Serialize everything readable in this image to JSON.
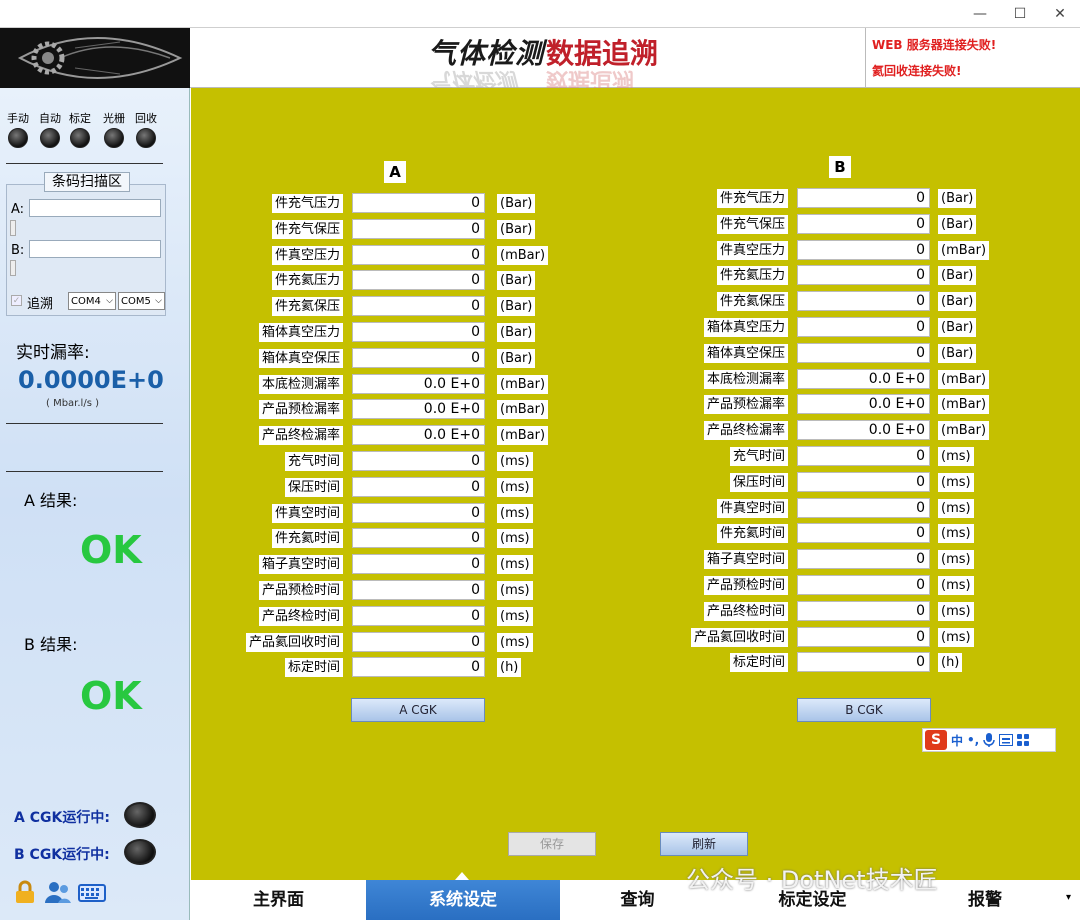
{
  "window": {
    "minimize": "—",
    "maximize": "☐",
    "close": "✕"
  },
  "header": {
    "title_part1": "气体检测",
    "title_part2": "数据追溯",
    "alert1": "WEB 服务器连接失败!",
    "alert2": "氦回收连接失败!"
  },
  "sidebar": {
    "modes": [
      "手动",
      "自动",
      "标定",
      "光栅",
      "回收"
    ],
    "scan_title": "条码扫描区",
    "scan_a_label": "A:",
    "scan_b_label": "B:",
    "trace_label": "追溯",
    "com_a": "COM4",
    "com_b": "COM5",
    "leak_title": "实时漏率:",
    "leak_value": "0.0000E+0",
    "leak_unit": "( Mbar.l/s )",
    "result_a_label": "A 结果:",
    "result_a": "OK",
    "result_b_label": "B 结果:",
    "result_b": "OK",
    "cgk_a": "A CGK运行中:",
    "cgk_b": "B CGK运行中:"
  },
  "panelA": {
    "header": "A",
    "rows": [
      {
        "label": "件充气压力",
        "value": "0",
        "unit": "(Bar)"
      },
      {
        "label": "件充气保压",
        "value": "0",
        "unit": "(Bar)"
      },
      {
        "label": "件真空压力",
        "value": "0",
        "unit": "(mBar)"
      },
      {
        "label": "件充氦压力",
        "value": "0",
        "unit": "(Bar)"
      },
      {
        "label": "件充氦保压",
        "value": "0",
        "unit": "(Bar)"
      },
      {
        "label": "箱体真空压力",
        "value": "0",
        "unit": "(Bar)"
      },
      {
        "label": "箱体真空保压",
        "value": "0",
        "unit": "(Bar)"
      },
      {
        "label": "本底检测漏率",
        "value": "0.0 E+0",
        "unit": "(mBar)"
      },
      {
        "label": "产品预检漏率",
        "value": "0.0 E+0",
        "unit": "(mBar)"
      },
      {
        "label": "产品终检漏率",
        "value": "0.0 E+0",
        "unit": "(mBar)"
      },
      {
        "label": "充气时间",
        "value": "0",
        "unit": "(ms)"
      },
      {
        "label": "保压时间",
        "value": "0",
        "unit": "(ms)"
      },
      {
        "label": "件真空时间",
        "value": "0",
        "unit": "(ms)"
      },
      {
        "label": "件充氦时间",
        "value": "0",
        "unit": "(ms)"
      },
      {
        "label": "箱子真空时间",
        "value": "0",
        "unit": "(ms)"
      },
      {
        "label": "产品预检时间",
        "value": "0",
        "unit": "(ms)"
      },
      {
        "label": "产品终检时间",
        "value": "0",
        "unit": "(ms)"
      },
      {
        "label": "产品氦回收时间",
        "value": "0",
        "unit": "(ms)"
      },
      {
        "label": "标定时间",
        "value": "0",
        "unit": "(h)"
      }
    ],
    "cgk_button": "A CGK"
  },
  "panelB": {
    "header": "B",
    "rows": [
      {
        "label": "件充气压力",
        "value": "0",
        "unit": "(Bar)"
      },
      {
        "label": "件充气保压",
        "value": "0",
        "unit": "(Bar)"
      },
      {
        "label": "件真空压力",
        "value": "0",
        "unit": "(mBar)"
      },
      {
        "label": "件充氦压力",
        "value": "0",
        "unit": "(Bar)"
      },
      {
        "label": "件充氦保压",
        "value": "0",
        "unit": "(Bar)"
      },
      {
        "label": "箱体真空压力",
        "value": "0",
        "unit": "(Bar)"
      },
      {
        "label": "箱体真空保压",
        "value": "0",
        "unit": "(Bar)"
      },
      {
        "label": "本底检测漏率",
        "value": "0.0 E+0",
        "unit": "(mBar)"
      },
      {
        "label": "产品预检漏率",
        "value": "0.0 E+0",
        "unit": "(mBar)"
      },
      {
        "label": "产品终检漏率",
        "value": "0.0 E+0",
        "unit": "(mBar)"
      },
      {
        "label": "充气时间",
        "value": "0",
        "unit": "(ms)"
      },
      {
        "label": "保压时间",
        "value": "0",
        "unit": "(ms)"
      },
      {
        "label": "件真空时间",
        "value": "0",
        "unit": "(ms)"
      },
      {
        "label": "件充氦时间",
        "value": "0",
        "unit": "(ms)"
      },
      {
        "label": "箱子真空时间",
        "value": "0",
        "unit": "(ms)"
      },
      {
        "label": "产品预检时间",
        "value": "0",
        "unit": "(ms)"
      },
      {
        "label": "产品终检时间",
        "value": "0",
        "unit": "(ms)"
      },
      {
        "label": "产品氦回收时间",
        "value": "0",
        "unit": "(ms)"
      },
      {
        "label": "标定时间",
        "value": "0",
        "unit": "(h)"
      }
    ],
    "cgk_button": "B CGK"
  },
  "actions": {
    "save": "保存",
    "refresh": "刷新"
  },
  "ime": {
    "logo": "S",
    "lang": "中",
    "punct": "•,"
  },
  "nav": {
    "tabs": [
      "主界面",
      "系统设定",
      "查询",
      "标定设定",
      "报警"
    ],
    "active": "系统设定"
  },
  "watermark": "公众号 · DotNet技术匠"
}
